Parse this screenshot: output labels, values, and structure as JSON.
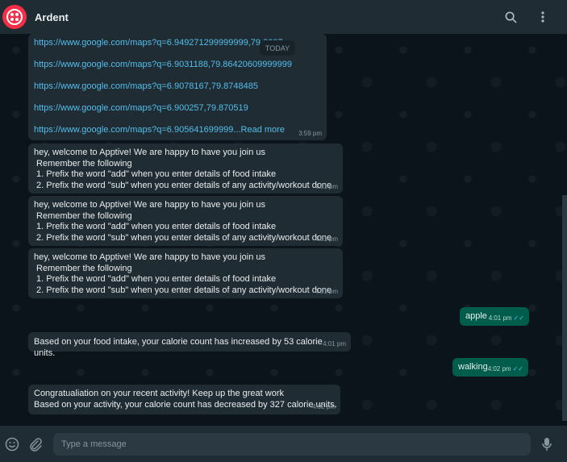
{
  "header": {
    "contact_name": "Ardent",
    "avatar_color": "#f22f46"
  },
  "icons": {
    "search": "search-icon",
    "menu": "more-vertical-icon",
    "emoji": "emoji-icon",
    "attach": "paperclip-icon",
    "mic": "microphone-icon"
  },
  "chat": {
    "date_divider": "TODAY",
    "links": [
      "https://www.google.com/maps?q=6.949271299999999,79.8607",
      "https://www.google.com/maps?q=6.9031188,79.86420609999999",
      "https://www.google.com/maps?q=6.9078167,79.8748485",
      "https://www.google.com/maps?q=6.900257,79.870519",
      "https://www.google.com/maps?q=6.905641699999"
    ],
    "links_read_more": "...Read more",
    "links_time": "3:59 pm",
    "welcome_messages": [
      {
        "lines": [
          "hey, welcome to Apptive! We are happy to have you join us",
          " Remember the following",
          " 1. Prefix the word \"add\" when you enter details of food intake",
          " 2. Prefix the word \"sub\" when you enter details of any activity/workout done"
        ],
        "time": "4:01 pm"
      },
      {
        "lines": [
          "hey, welcome to Apptive! We are happy to have you join us",
          " Remember the following",
          " 1. Prefix the word \"add\" when you enter details of food intake",
          " 2. Prefix the word \"sub\" when you enter details of any activity/workout done"
        ],
        "time": "4:01 pm"
      },
      {
        "lines": [
          "hey, welcome to Apptive! We are happy to have you join us",
          " Remember the following",
          " 1. Prefix the word \"add\" when you enter details of food intake",
          " 2. Prefix the word \"sub\" when you enter details of any activity/workout done"
        ],
        "time": "4:01 pm"
      }
    ],
    "out_apple": {
      "text": "apple",
      "time": "4:01 pm"
    },
    "calorie_increase": {
      "text": "Based on your food intake, your calorie count has increased by 53 calorie units.",
      "time": "4:01 pm"
    },
    "out_walking": {
      "text": "walking",
      "time": "4:02 pm"
    },
    "activity_message": {
      "lines": [
        "Congratualiation on your recent activity! Keep up the great work",
        "Based on your activity, your calorie count has decreased by 327 calorie units."
      ],
      "time": "4:02 pm"
    }
  },
  "composer": {
    "placeholder": "Type a message"
  },
  "colors": {
    "incoming_bubble": "#202c33",
    "outgoing_bubble": "#005c4b",
    "link": "#53bdeb",
    "read_ticks": "#53bdeb"
  }
}
